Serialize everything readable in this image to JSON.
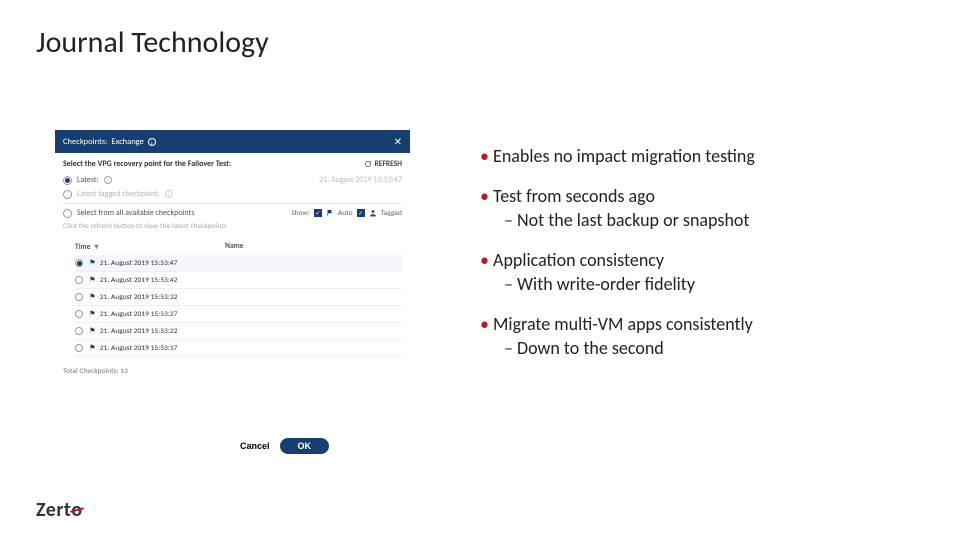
{
  "title": "Journal Technology",
  "panel": {
    "header_prefix": "Checkpoints:",
    "header_name": "Exchange",
    "subtitle": "Select the VPG recovery point for the Failover Test:",
    "refresh_label": "REFRESH",
    "latest_label": "Latest:",
    "latest_ts": "21. August 2019 15:53:47",
    "latest_tagged_label": "Latest tagged checkpoint:",
    "select_label": "Select from all available checkpoints",
    "show_label": "Show:",
    "filter_auto": "Auto",
    "filter_tagged": "Tagged",
    "hint": "Click the refresh button to view the latest checkpoints",
    "col_time": "Time",
    "col_name": "Name",
    "rows": [
      "21. August 2019 15:53:47",
      "21. August 2019 15:53:42",
      "21. August 2019 15:53:32",
      "21. August 2019 15:53:27",
      "21. August 2019 15:53:22",
      "21. August 2019 15:53:17"
    ],
    "total_label": "Total Checkpoints:",
    "total_value": "13",
    "cancel": "Cancel",
    "ok": "OK"
  },
  "bullets": {
    "b1": "Enables no impact migration testing",
    "b2": "Test from seconds ago",
    "b2s": "Not the last backup or snapshot",
    "b3": "Application consistency",
    "b3s": "With write-order fidelity",
    "b4": "Migrate multi-VM apps consistently",
    "b4s": "Down to the second"
  },
  "logo": {
    "text": "Zert"
  }
}
